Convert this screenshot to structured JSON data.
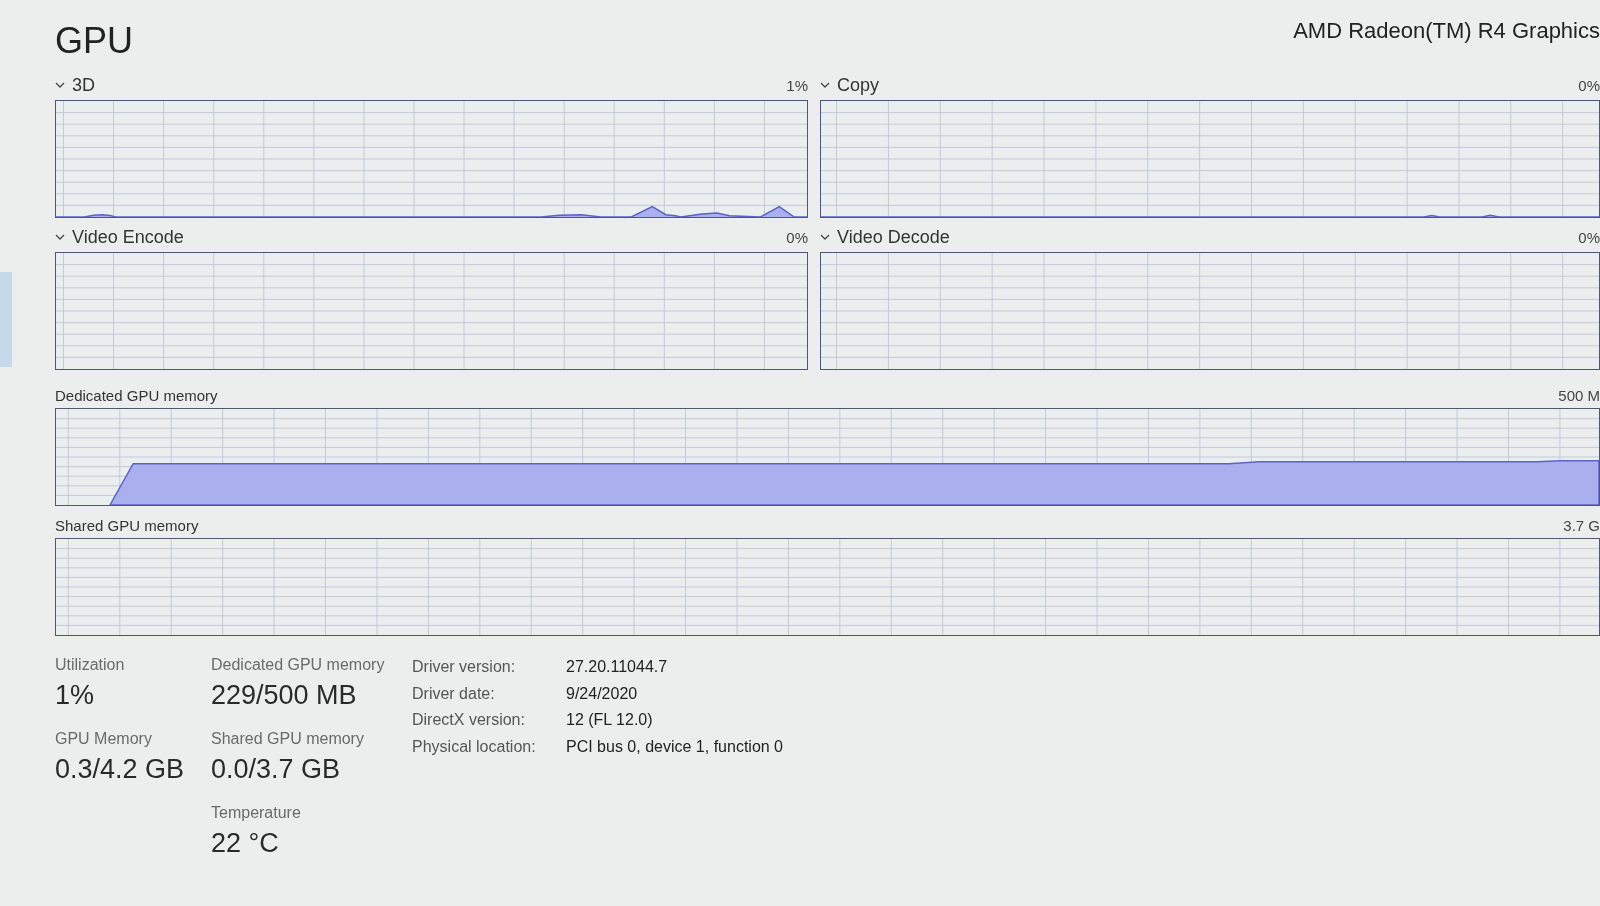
{
  "header": {
    "title": "GPU",
    "device_name": "AMD Radeon(TM) R4 Graphics"
  },
  "engine_graphs": [
    {
      "label": "3D",
      "value": "1%"
    },
    {
      "label": "Copy",
      "value": "0%"
    },
    {
      "label": "Video Encode",
      "value": "0%"
    },
    {
      "label": "Video Decode",
      "value": "0%"
    }
  ],
  "memory_graphs": [
    {
      "label": "Dedicated GPU memory",
      "max": "500 M"
    },
    {
      "label": "Shared GPU memory",
      "max": "3.7 G"
    }
  ],
  "stat_columns": [
    {
      "items": [
        {
          "label": "Utilization",
          "value": "1%"
        },
        {
          "label": "GPU Memory",
          "value": "0.3/4.2 GB"
        }
      ]
    },
    {
      "items": [
        {
          "label": "Dedicated GPU memory",
          "value": "229/500 MB"
        },
        {
          "label": "Shared GPU memory",
          "value": "0.0/3.7 GB"
        },
        {
          "label": "Temperature",
          "value": "22 °C"
        }
      ]
    }
  ],
  "details": [
    {
      "label": "Driver version:",
      "value": "27.20.11044.7"
    },
    {
      "label": "Driver date:",
      "value": "9/24/2020"
    },
    {
      "label": "DirectX version:",
      "value": "12 (FL 12.0)"
    },
    {
      "label": "Physical location:",
      "value": "PCI bus 0, device 1, function 0"
    }
  ]
}
